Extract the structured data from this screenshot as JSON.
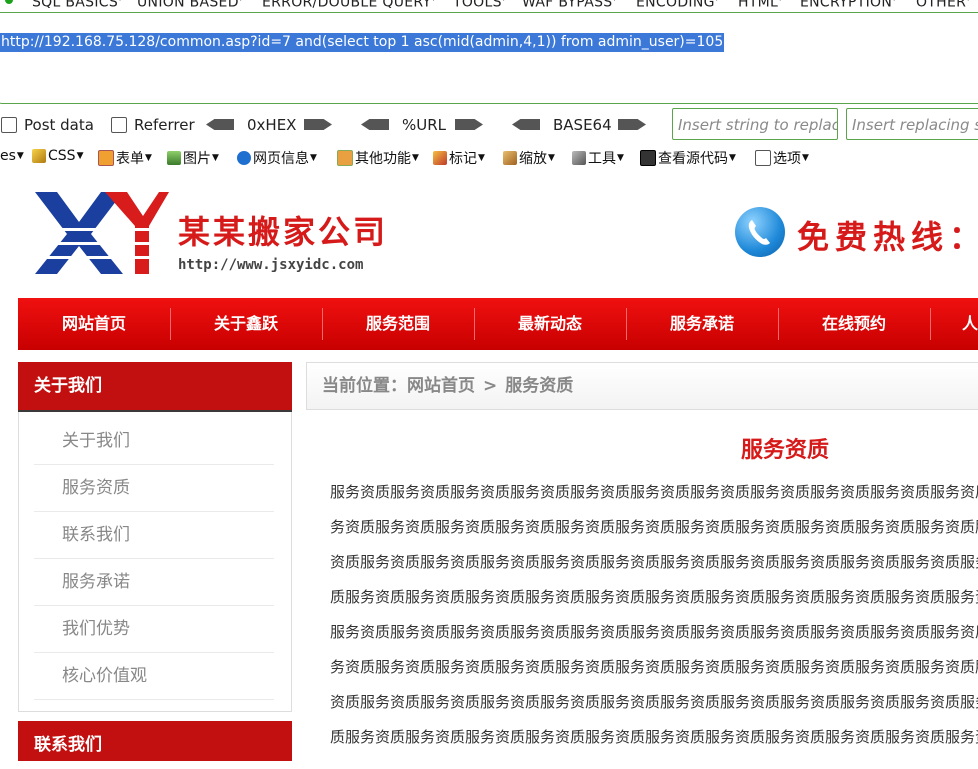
{
  "hackbar": {
    "menu": [
      "SQL BASICS",
      "UNION BASED",
      "ERROR/DOUBLE QUERY",
      "TOOLS",
      "WAF BYPASS",
      "ENCODING",
      "HTML",
      "ENCRYPTION",
      "OTHER"
    ],
    "url": "http://192.168.75.128/common.asp?id=7 and(select top 1 asc(mid(admin,4,1)) from admin_user)=105",
    "post_label": "Post data",
    "referrer_label": "Referrer",
    "hex_label": "0xHEX",
    "url_enc_label": "%URL",
    "base64_label": "BASE64",
    "replace_placeholder": "Insert string to replace",
    "replacing_placeholder": "Insert replacing string"
  },
  "webdev_toolbar": {
    "items": [
      "es",
      "CSS",
      "表单",
      "图片",
      "网页信息",
      "其他功能",
      "标记",
      "缩放",
      "工具",
      "查看源代码",
      "选项"
    ]
  },
  "site": {
    "brand_letters": "XY",
    "company_name": "某某搬家公司",
    "company_url": "http://www.jsxyidc.com",
    "hotline": "免费热线：",
    "nav": [
      "网站首页",
      "关于鑫跃",
      "服务范围",
      "最新动态",
      "服务承诺",
      "在线预约",
      "人"
    ],
    "sidebar": {
      "title": "关于我们",
      "items": [
        "关于我们",
        "服务资质",
        "联系我们",
        "服务承诺",
        "我们优势",
        "核心价值观"
      ],
      "title2": "联系我们"
    },
    "breadcrumb": {
      "prefix": "当前位置：",
      "home": "网站首页",
      "sep": ">",
      "current": "服务资质"
    },
    "article": {
      "title": "服务资质",
      "lines": [
        "服务资质服务资质服务资质服务资质服务资质服务资质服务资质服务资质服务资质服务资质服务资质服",
        "务资质服务资质服务资质服务资质服务资质服务资质服务资质服务资质服务资质服务资质服务资质服务",
        "资质服务资质服务资质服务资质服务资质服务资质服务资质服务资质服务资质服务资质服务资质服务资",
        "质服务资质服务资质服务资质服务资质服务资质服务资质服务资质服务资质服务资质服务资质服务资质",
        "服务资质服务资质服务资质服务资质服务资质服务资质服务资质服务资质服务资质服务资质服务资质服",
        "务资质服务资质服务资质服务资质服务资质服务资质服务资质服务资质服务资质服务资质服务资质服务",
        "资质服务资质服务资质服务资质服务资质服务资质服务资质服务资质服务资质服务资质服务资质服务资",
        "质服务资质服务资质服务资质服务资质服务资质服务资质服务资质服务资质服务资质服务资质服务资质"
      ]
    }
  },
  "colors": {
    "accent_red": "#d61a1a",
    "nav_red": "#e60a0a",
    "hackbar_green": "#5aa54a",
    "selection_blue": "#3b78d8"
  }
}
